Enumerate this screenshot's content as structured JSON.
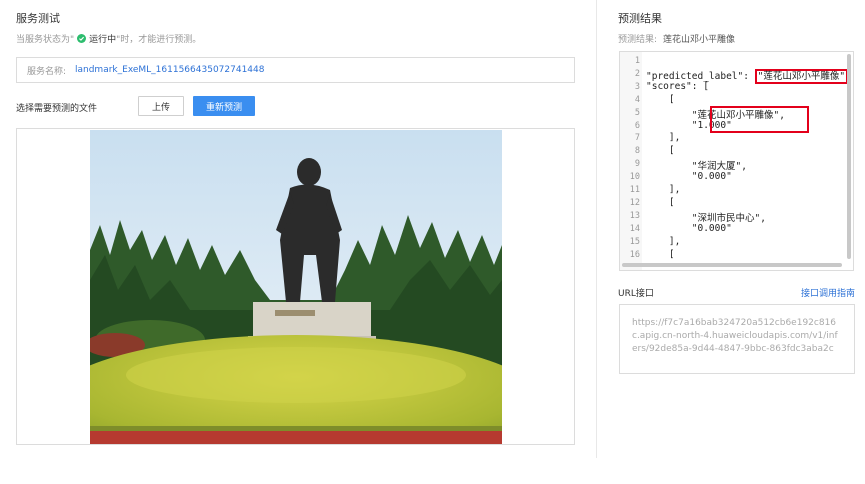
{
  "left": {
    "title": "服务测试",
    "status": {
      "prefix": "当服务状态为\"",
      "state": "运行中",
      "suffix": "\"时，才能进行预测。"
    },
    "service": {
      "label": "服务名称:",
      "name": "landmark_ExeML_1611566435072741448"
    },
    "file_label": "选择需要预测的文件",
    "upload_label": "上传",
    "predict_label": "重新预测"
  },
  "right": {
    "title": "预测结果",
    "summary_label": "预测结果:",
    "summary_value": "莲花山邓小平雕像",
    "code_lines": [
      {
        "n": "1",
        "t": ""
      },
      {
        "n": "2",
        "t": "\"predicted_label\": "
      },
      {
        "n": "3",
        "t": "\"scores\": ["
      },
      {
        "n": "4",
        "t": "    ["
      },
      {
        "n": "5",
        "t": "        \"莲花山邓小平雕像\","
      },
      {
        "n": "6",
        "t": "        \"1.000\""
      },
      {
        "n": "7",
        "t": "    ],"
      },
      {
        "n": "8",
        "t": "    ["
      },
      {
        "n": "9",
        "t": "        \"华润大厦\","
      },
      {
        "n": "10",
        "t": "        \"0.000\""
      },
      {
        "n": "11",
        "t": "    ],"
      },
      {
        "n": "12",
        "t": "    ["
      },
      {
        "n": "13",
        "t": "        \"深圳市民中心\","
      },
      {
        "n": "14",
        "t": "        \"0.000\""
      },
      {
        "n": "15",
        "t": "    ],"
      },
      {
        "n": "16",
        "t": "    ["
      }
    ],
    "predicted_value": "\"莲花山邓小平雕像\"",
    "url_label": "URL接口",
    "url_guide": "接口调用指南",
    "url": "https://f7c7a16bab324720a512cb6e192c816c.apig.cn-north-4.huaweicloudapis.com/v1/infers/92de85a-9d44-4847-9bbc-863fdc3aba2c"
  }
}
